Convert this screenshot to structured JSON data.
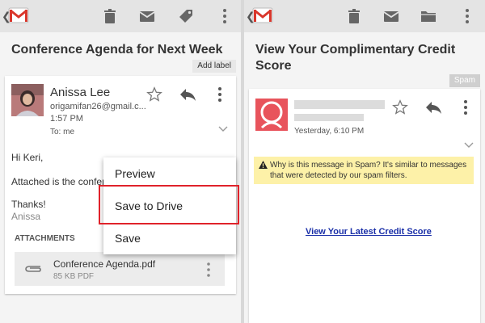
{
  "left": {
    "subject": "Conference Agenda for Next Week",
    "add_label": "Add label",
    "sender": {
      "name": "Anissa Lee",
      "email": "origamifan26@gmail.c...",
      "time": "1:57 PM",
      "to": "To: me"
    },
    "body": {
      "greeting": "Hi Keri,",
      "line": "Attached is the confer",
      "thanks": "Thanks!",
      "signature": "Anissa"
    },
    "attachments_heading": "ATTACHMENTS",
    "attachment": {
      "filename": "Conference Agenda.pdf",
      "meta": "85 KB PDF"
    },
    "menu": {
      "preview": "Preview",
      "save_to_drive": "Save to Drive",
      "save": "Save"
    }
  },
  "right": {
    "subject": "View Your Complimentary Credit Score",
    "spam_label": "Spam",
    "time": "Yesterday, 6:10 PM",
    "spam_warning": "Why is this message in Spam? It's similar to messages that were detected by our spam filters.",
    "link": "View Your Latest Credit Score"
  },
  "icons": {
    "logo": "gmail-icon",
    "back": "chevron-left-icon",
    "delete": "trash-icon",
    "archive": "archive-icon",
    "label": "label-icon",
    "move": "folder-icon",
    "overflow": "more-vert-icon",
    "star": "star-icon",
    "reply": "reply-icon",
    "paperclip": "paperclip-icon",
    "expand": "chevron-down-icon",
    "warning": "warning-icon",
    "avatar": "avatar-icon"
  },
  "colors": {
    "appbar": "#e4e4e4",
    "gmail_red": "#d9362b",
    "highlight": "#e0222a",
    "link": "#1a2fa8",
    "spam_warning_bg": "#fdf1a8",
    "avatar_bg": "#e8545c"
  }
}
